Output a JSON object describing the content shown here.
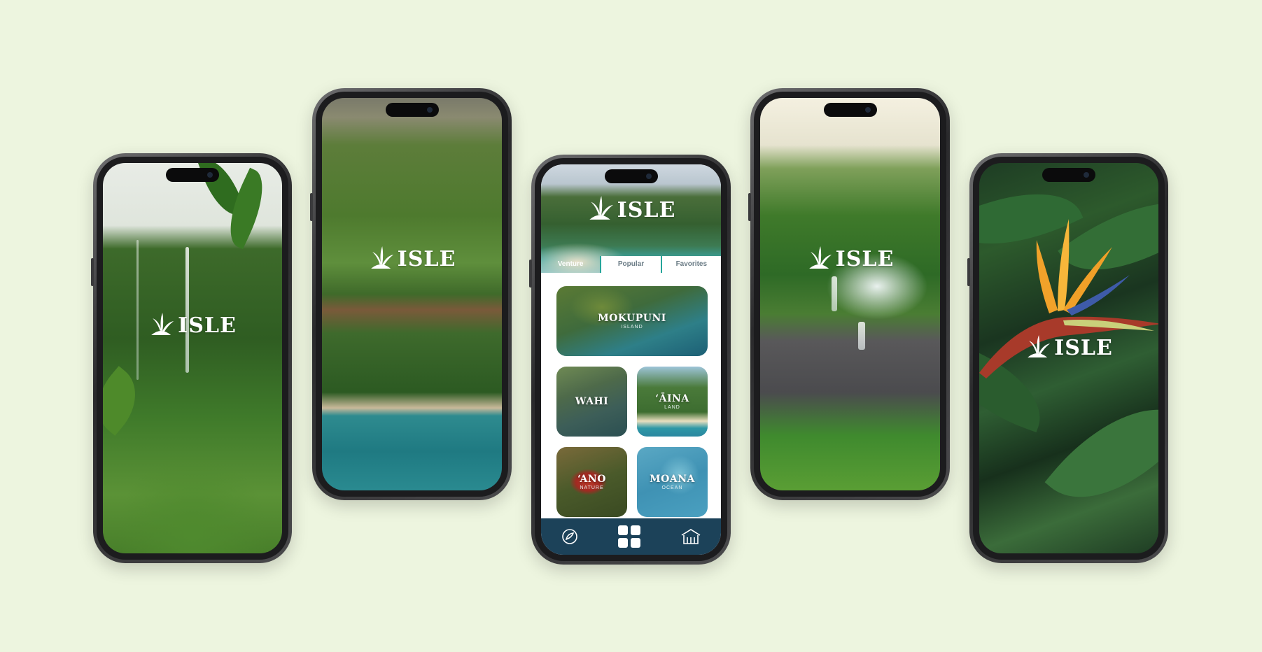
{
  "app": {
    "logo_text": "ISLE"
  },
  "colors": {
    "background": "#edf5df",
    "nav_bar": "#1c4259",
    "accent_teal": "#26a59a",
    "tab_inactive_text": "#6b7c86"
  },
  "phones": [
    {
      "screen": "splash",
      "background": "waterfall valley"
    },
    {
      "screen": "splash",
      "background": "aerial coastline"
    },
    {
      "screen": "home"
    },
    {
      "screen": "splash",
      "background": "jungle waterfall"
    },
    {
      "screen": "splash",
      "background": "bird of paradise flower"
    }
  ],
  "home": {
    "tabs": [
      {
        "label": "Venture",
        "active": true
      },
      {
        "label": "Popular",
        "active": false
      },
      {
        "label": "Favorites",
        "active": false
      }
    ],
    "cards": [
      {
        "title": "MOKUPUNI",
        "subtitle": "ISLAND"
      },
      {
        "title": "WAHI",
        "subtitle": ""
      },
      {
        "title": "ʻĀINA",
        "subtitle": "LAND"
      },
      {
        "title": "ʻANO",
        "subtitle": "NATURE"
      },
      {
        "title": "MOANA",
        "subtitle": "OCEAN"
      }
    ],
    "nav": [
      {
        "icon": "explore-icon"
      },
      {
        "icon": "grid-icon"
      },
      {
        "icon": "house-icon"
      }
    ]
  }
}
